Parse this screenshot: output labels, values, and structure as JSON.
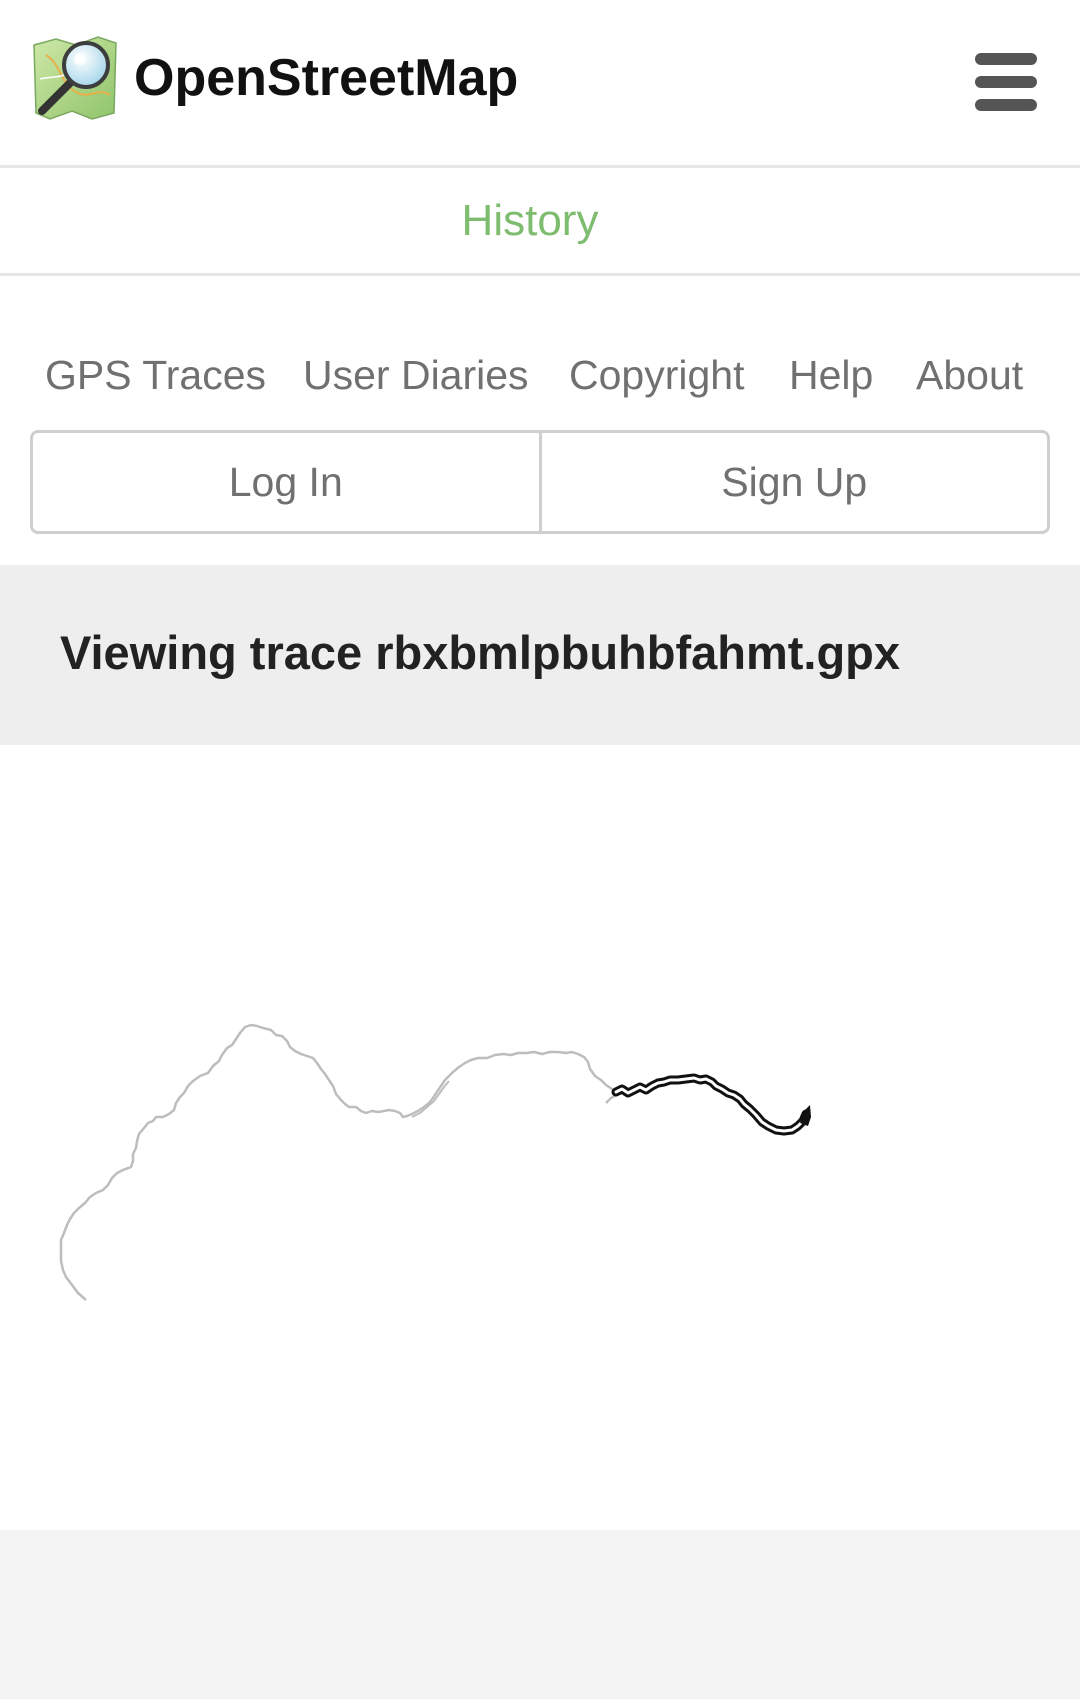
{
  "header": {
    "brand_name": "OpenStreetMap",
    "logo_icon": "openstreetmap-logo-icon",
    "menu_icon": "hamburger-menu-icon"
  },
  "tabs": {
    "history_label": "History"
  },
  "nav": {
    "items": [
      {
        "label": "GPS Traces"
      },
      {
        "label": "User Diaries"
      },
      {
        "label": "Copyright"
      },
      {
        "label": "Help"
      },
      {
        "label": "About"
      }
    ]
  },
  "auth": {
    "login_label": "Log In",
    "signup_label": "Sign Up"
  },
  "main": {
    "title": "Viewing trace rbxbmlpbuhbfahmt.gpx"
  },
  "colors": {
    "accent_green": "#7ebc6f",
    "nav_text": "#707070",
    "title_band": "#eeeeee",
    "trace_gray": "#bdbdbd",
    "trace_dark": "#111111"
  }
}
